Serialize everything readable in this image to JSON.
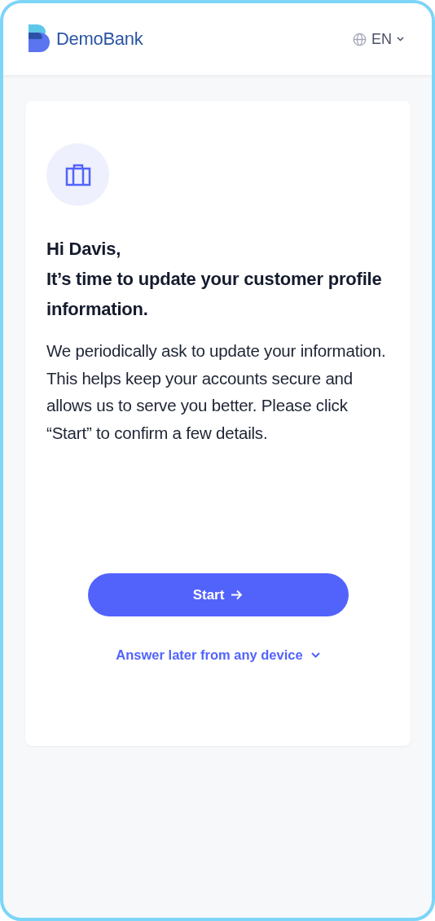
{
  "header": {
    "brand": "DemoBank",
    "language": "EN"
  },
  "card": {
    "greeting": "Hi Davis,",
    "headline": "It’s time to update your customer profile information.",
    "body": "We periodically ask to update your information. This helps keep your accounts secure and allows us to serve you better. Please click “Start” to confirm a few details.",
    "primary_button": "Start",
    "secondary_link": "Answer later from any device"
  }
}
